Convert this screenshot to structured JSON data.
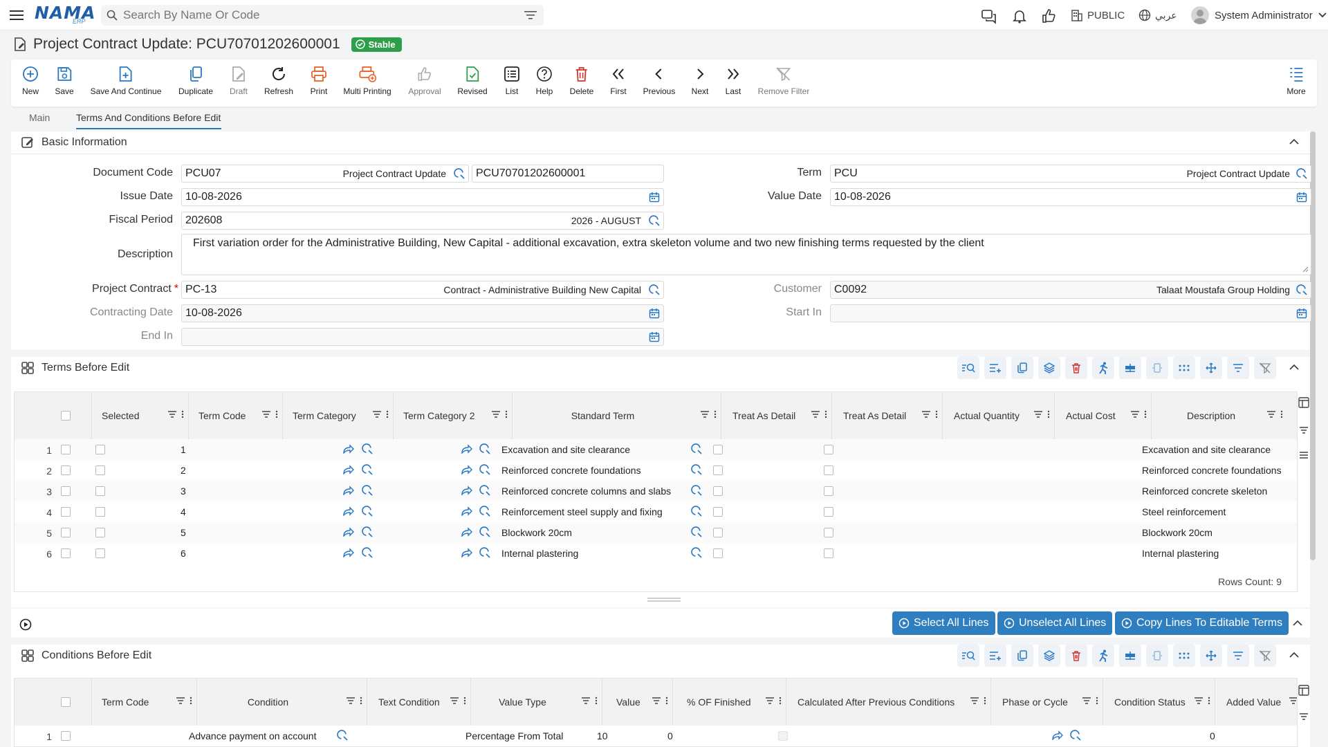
{
  "brand": {
    "name": "NAMA",
    "sub": "ERP"
  },
  "search": {
    "placeholder": "Search By Name Or Code"
  },
  "header": {
    "public_label": "PUBLIC",
    "language_label": "عربي",
    "user_name": "System Administrator"
  },
  "page": {
    "title": "Project Contract Update: PCU70701202600001",
    "status": "Stable"
  },
  "toolbar": {
    "new": "New",
    "save": "Save",
    "save_continue": "Save And Continue",
    "duplicate": "Duplicate",
    "draft": "Draft",
    "refresh": "Refresh",
    "print": "Print",
    "multi_printing": "Multi Printing",
    "approval": "Approval",
    "revised": "Revised",
    "list": "List",
    "help": "Help",
    "delete": "Delete",
    "first": "First",
    "previous": "Previous",
    "next": "Next",
    "last": "Last",
    "remove_filter": "Remove Filter",
    "more": "More"
  },
  "tabs": {
    "main": "Main",
    "terms_before_edit": "Terms And Conditions Before Edit"
  },
  "basic_info": {
    "title": "Basic Information",
    "document_code": {
      "label": "Document Code",
      "code": "PCU07",
      "name": "Project Contract Update",
      "number": "PCU70701202600001"
    },
    "term": {
      "label": "Term",
      "code": "PCU",
      "name": "Project Contract Update"
    },
    "issue_date": {
      "label": "Issue Date",
      "value": "10-08-2026"
    },
    "value_date": {
      "label": "Value Date",
      "value": "10-08-2026"
    },
    "fiscal_period": {
      "label": "Fiscal Period",
      "value": "202608",
      "name": "2026 - AUGUST"
    },
    "description": {
      "label": "Description",
      "value": "First variation order for the Administrative Building, New Capital - additional excavation, extra skeleton volume and two new finishing terms requested by the client"
    },
    "project_contract": {
      "label": "Project Contract",
      "code": "PC-13",
      "name": "Contract - Administrative Building New Capital"
    },
    "customer": {
      "label": "Customer",
      "code": "C0092",
      "name": "Talaat Moustafa Group Holding"
    },
    "contracting_date": {
      "label": "Contracting Date",
      "value": "10-08-2026"
    },
    "start_in": {
      "label": "Start In",
      "value": ""
    },
    "end_in": {
      "label": "End In",
      "value": ""
    }
  },
  "terms_grid": {
    "title": "Terms Before Edit",
    "columns": [
      "Selected",
      "Term Code",
      "Term Category",
      "Term Category 2",
      "Standard Term",
      "Treat As Detail",
      "Treat As Detail",
      "Actual Quantity",
      "Actual Cost",
      "Description"
    ],
    "rows": [
      {
        "n": "1",
        "code": "1",
        "standard": "Excavation and site clearance",
        "desc": "Excavation and site clearance"
      },
      {
        "n": "2",
        "code": "2",
        "standard": "Reinforced concrete foundations",
        "desc": "Reinforced concrete foundations"
      },
      {
        "n": "3",
        "code": "3",
        "standard": "Reinforced concrete columns and slabs",
        "desc": "Reinforced concrete skeleton"
      },
      {
        "n": "4",
        "code": "4",
        "standard": "Reinforcement steel supply and fixing",
        "desc": "Steel reinforcement"
      },
      {
        "n": "5",
        "code": "5",
        "standard": "Blockwork 20cm",
        "desc": "Blockwork 20cm"
      },
      {
        "n": "6",
        "code": "6",
        "standard": "Internal plastering",
        "desc": "Internal plastering"
      }
    ],
    "rows_count": "Rows Count: 9"
  },
  "actions": {
    "select_all": "Select All Lines",
    "unselect_all": "Unselect All Lines",
    "copy_lines": "Copy Lines To Editable Terms"
  },
  "conditions_grid": {
    "title": "Conditions Before Edit",
    "columns": [
      "Term Code",
      "Condition",
      "Text Condition",
      "Value Type",
      "Value",
      "% OF Finished",
      "Calculated After Previous Conditions",
      "Phase or Cycle",
      "Condition Status",
      "Added Value"
    ],
    "rows": [
      {
        "n": "1",
        "condition": "Advance payment on account",
        "value_type": "Percentage From Total",
        "value": "10",
        "finished": "0",
        "added": "0"
      }
    ]
  },
  "colors": {
    "accent": "#2778c4",
    "stable": "#2e9e4a",
    "danger": "#d0342c",
    "orange": "#e8632a"
  }
}
